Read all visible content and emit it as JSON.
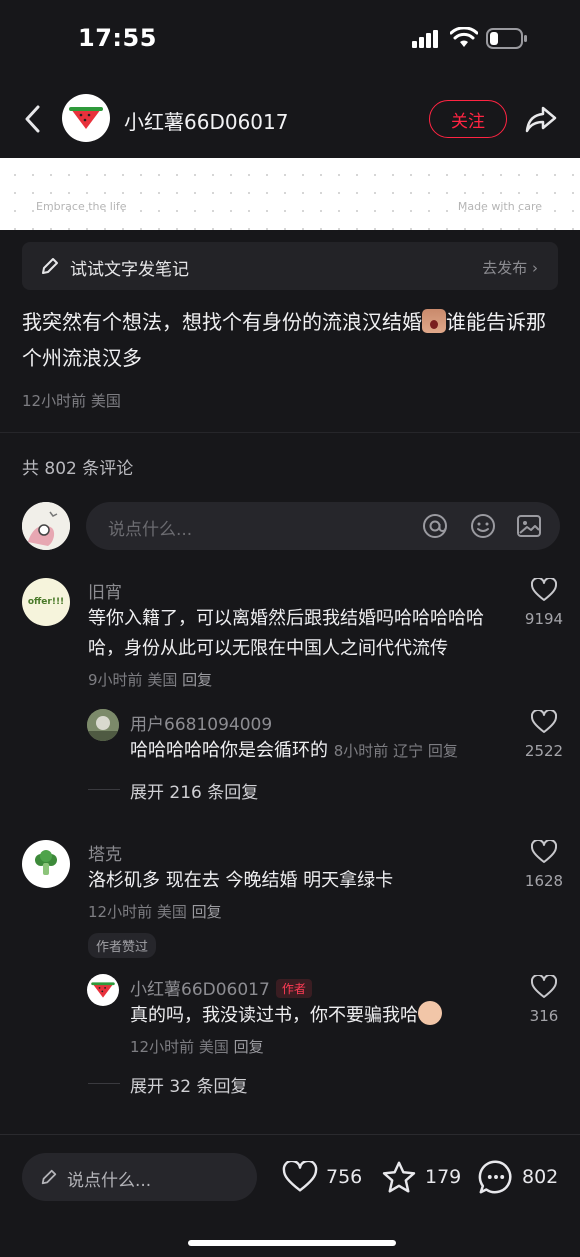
{
  "status": {
    "time": "17:55"
  },
  "header": {
    "user_name": "小红薯66D06017",
    "follow_label": "关注"
  },
  "banner": {
    "left_text": "Embrace the life",
    "right_text": "Made with care"
  },
  "try_note": {
    "label": "试试文字发笔记",
    "action": "去发布"
  },
  "post": {
    "text_part1": "我突然有个想法，想找个有身份的流浪汉结婚",
    "text_part2": "谁能告诉那个州流浪汉多",
    "time": "12小时前",
    "location": "美国"
  },
  "comments_count": "共 802 条评论",
  "comment_input": {
    "placeholder": "说点什么..."
  },
  "comments": [
    {
      "name": "旧宵",
      "text": "等你入籍了，可以离婚然后跟我结婚吗哈哈哈哈哈哈，身份从此可以无限在中国人之间代代流传",
      "time": "9小时前",
      "location": "美国",
      "reply_label": "回复",
      "likes": "9194",
      "avatar_text": "offer!!!",
      "replies": [
        {
          "name": "用户6681094009",
          "text": "哈哈哈哈哈你是会循环的",
          "time": "8小时前",
          "location": "辽宁",
          "reply_label": "回复",
          "likes": "2522"
        }
      ],
      "expand_label": "展开 216 条回复"
    },
    {
      "name": "塔克",
      "text": "洛杉矶多 现在去 今晚结婚 明天拿绿卡",
      "time": "12小时前",
      "location": "美国",
      "reply_label": "回复",
      "likes": "1628",
      "author_liked": "作者赞过",
      "replies": [
        {
          "name": "小红薯66D06017",
          "author_tag": "作者",
          "text": "真的吗，我没读过书，你不要骗我哈",
          "time": "12小时前",
          "location": "美国",
          "reply_label": "回复",
          "likes": "316"
        }
      ],
      "expand_label": "展开 32 条回复"
    }
  ],
  "bottom_bar": {
    "placeholder": "说点什么...",
    "likes": "756",
    "stars": "179",
    "comments": "802"
  },
  "colors": {
    "accent": "#ff2442",
    "background": "#17171a"
  }
}
